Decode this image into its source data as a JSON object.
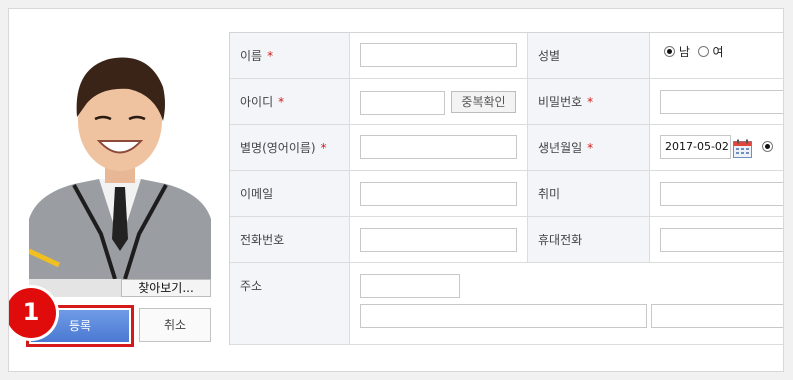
{
  "photo": {
    "alt": "student photo"
  },
  "upload": {
    "browse_label": "찾아보기..."
  },
  "actions": {
    "register_label": "등록",
    "cancel_label": "취소"
  },
  "step_marker": "1",
  "required_mark": "*",
  "form": {
    "name_label": "이름",
    "gender_label": "성별",
    "gender_male": "남",
    "gender_female": "여",
    "userid_label": "아이디",
    "dup_check_label": "중복확인",
    "password_label": "비밀번호",
    "nickname_label": "별명(영어이름)",
    "birthday_label": "생년월일",
    "birthday_value": "2017-05-02",
    "email_label": "이메일",
    "hobby_label": "취미",
    "phone_label": "전화번호",
    "mobile_label": "휴대전화",
    "address_label": "주소"
  }
}
